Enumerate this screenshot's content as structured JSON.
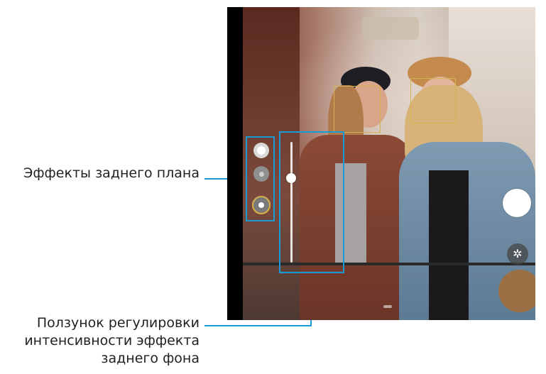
{
  "callouts": {
    "background_effects": "Эффекты заднего плана",
    "intensity_slider_lines": [
      "Ползунок регулировки",
      "интенсивности эффекта",
      "заднего фона"
    ]
  },
  "slider": {
    "level_fraction": 0.3
  },
  "effects": {
    "selected_index": 2,
    "count": 3
  },
  "icons": {
    "flash": "flash-icon"
  },
  "colors": {
    "callout_line": "#1a9ad6",
    "focus_box": "#d4b24c",
    "selected_effect": "#d8b04c"
  }
}
